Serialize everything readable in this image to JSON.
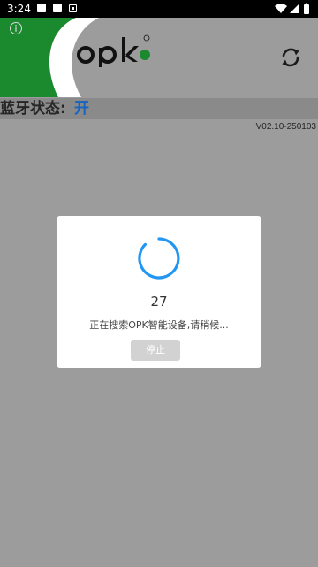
{
  "status_bar": {
    "time": "3:24"
  },
  "header": {
    "logo_text": "opk",
    "logo_mark": "®"
  },
  "bluetooth": {
    "label": "蓝牙状态:",
    "value": "开"
  },
  "version": "V02.10-250103",
  "dialog": {
    "countdown": "27",
    "message": "正在搜索OPK智能设备,请稍候...",
    "stop_label": "停止"
  },
  "colors": {
    "brand_green": "#1b8a2e",
    "bt_on_blue": "#1565c0",
    "spinner_blue": "#2196f3"
  }
}
